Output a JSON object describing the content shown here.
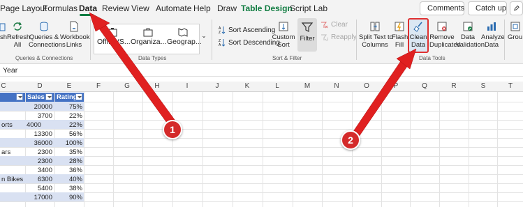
{
  "tabs": [
    {
      "label": "Page Layout",
      "active": false
    },
    {
      "label": "Formulas",
      "active": false
    },
    {
      "label": "Data",
      "active": true
    },
    {
      "label": "Review",
      "active": false
    },
    {
      "label": "View",
      "active": false
    },
    {
      "label": "Automate",
      "active": false
    },
    {
      "label": "Help",
      "active": false
    },
    {
      "label": "Draw",
      "active": false
    },
    {
      "label": "Table Design",
      "active": false
    },
    {
      "label": "Script Lab",
      "active": false
    }
  ],
  "top_right": {
    "comments": "Comments",
    "catch_up": "Catch up"
  },
  "ribbon": {
    "queries": {
      "refresh_partial": "sh",
      "refresh_all": "Refresh\nAll",
      "queries_connections": "Queries &\nConnections",
      "workbook_links": "Workbook\nLinks",
      "group_label": "Queries & Connections"
    },
    "data_types": {
      "cards": [
        "Offi...VS...",
        "Organiza...",
        "Geograp..."
      ],
      "group_label": "Data Types"
    },
    "sort_filter": {
      "sort_ascending": "Sort Ascending",
      "sort_descending": "Sort Descending",
      "custom_sort": "Custom\nSort",
      "filter": "Filter",
      "clear": "Clear",
      "reapply": "Reapply",
      "group_label": "Sort & Filter"
    },
    "data_tools": {
      "split_text": "Split Text to\nColumns",
      "flash_fill": "Flash\nFill",
      "clean_data": "Clean\nData",
      "remove_duplicates": "Remove\nDuplicates",
      "data_validation": "Data\nValidation",
      "analyze_data": "Analyze\nData",
      "group_partial": "Grou",
      "group_label": "Data Tools"
    }
  },
  "formula_bar": {
    "text": "Year"
  },
  "columns": [
    "C",
    "D",
    "E",
    "F",
    "G",
    "H",
    "I",
    "J",
    "K",
    "L",
    "M",
    "N",
    "O",
    "P",
    "Q",
    "R",
    "S",
    "T"
  ],
  "table": {
    "headers": [
      "Sales",
      "Rating"
    ],
    "rows": [
      {
        "c": "",
        "sales": "20000",
        "rating": "75%"
      },
      {
        "c": "",
        "sales": "3700",
        "rating": "22%"
      },
      {
        "c": "orts",
        "sales": "4000",
        "rating": "22%"
      },
      {
        "c": "",
        "sales": "13300",
        "rating": "56%"
      },
      {
        "c": "",
        "sales": "36000",
        "rating": "100%"
      },
      {
        "c": "ars",
        "sales": "2300",
        "rating": "35%"
      },
      {
        "c": "",
        "sales": "2300",
        "rating": "28%"
      },
      {
        "c": "",
        "sales": "3400",
        "rating": "36%"
      },
      {
        "c": "n Bikes",
        "sales": "6300",
        "rating": "40%"
      },
      {
        "c": "",
        "sales": "5400",
        "rating": "38%"
      },
      {
        "c": "",
        "sales": "17000",
        "rating": "90%"
      }
    ]
  },
  "annotations": {
    "badge1": "1",
    "badge2": "2"
  },
  "colors": {
    "accent_green": "#107c41",
    "table_header": "#4472c4",
    "table_band": "#d9e1f2",
    "annotation_red": "#e02020"
  }
}
